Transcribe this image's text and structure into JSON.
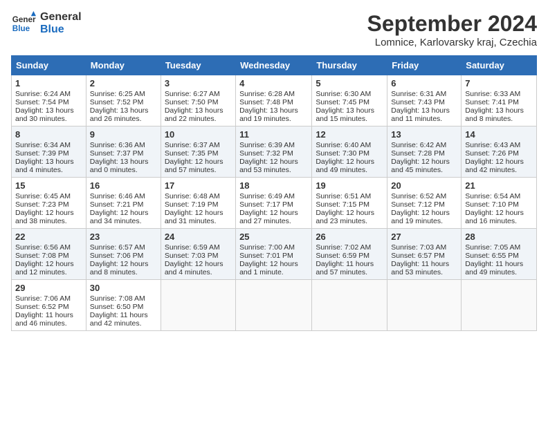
{
  "header": {
    "logo_line1": "General",
    "logo_line2": "Blue",
    "month_title": "September 2024",
    "location": "Lomnice, Karlovarsky kraj, Czechia"
  },
  "columns": [
    "Sunday",
    "Monday",
    "Tuesday",
    "Wednesday",
    "Thursday",
    "Friday",
    "Saturday"
  ],
  "weeks": [
    [
      {
        "day": "1",
        "info": "Sunrise: 6:24 AM\nSunset: 7:54 PM\nDaylight: 13 hours\nand 30 minutes."
      },
      {
        "day": "2",
        "info": "Sunrise: 6:25 AM\nSunset: 7:52 PM\nDaylight: 13 hours\nand 26 minutes."
      },
      {
        "day": "3",
        "info": "Sunrise: 6:27 AM\nSunset: 7:50 PM\nDaylight: 13 hours\nand 22 minutes."
      },
      {
        "day": "4",
        "info": "Sunrise: 6:28 AM\nSunset: 7:48 PM\nDaylight: 13 hours\nand 19 minutes."
      },
      {
        "day": "5",
        "info": "Sunrise: 6:30 AM\nSunset: 7:45 PM\nDaylight: 13 hours\nand 15 minutes."
      },
      {
        "day": "6",
        "info": "Sunrise: 6:31 AM\nSunset: 7:43 PM\nDaylight: 13 hours\nand 11 minutes."
      },
      {
        "day": "7",
        "info": "Sunrise: 6:33 AM\nSunset: 7:41 PM\nDaylight: 13 hours\nand 8 minutes."
      }
    ],
    [
      {
        "day": "8",
        "info": "Sunrise: 6:34 AM\nSunset: 7:39 PM\nDaylight: 13 hours\nand 4 minutes."
      },
      {
        "day": "9",
        "info": "Sunrise: 6:36 AM\nSunset: 7:37 PM\nDaylight: 13 hours\nand 0 minutes."
      },
      {
        "day": "10",
        "info": "Sunrise: 6:37 AM\nSunset: 7:35 PM\nDaylight: 12 hours\nand 57 minutes."
      },
      {
        "day": "11",
        "info": "Sunrise: 6:39 AM\nSunset: 7:32 PM\nDaylight: 12 hours\nand 53 minutes."
      },
      {
        "day": "12",
        "info": "Sunrise: 6:40 AM\nSunset: 7:30 PM\nDaylight: 12 hours\nand 49 minutes."
      },
      {
        "day": "13",
        "info": "Sunrise: 6:42 AM\nSunset: 7:28 PM\nDaylight: 12 hours\nand 45 minutes."
      },
      {
        "day": "14",
        "info": "Sunrise: 6:43 AM\nSunset: 7:26 PM\nDaylight: 12 hours\nand 42 minutes."
      }
    ],
    [
      {
        "day": "15",
        "info": "Sunrise: 6:45 AM\nSunset: 7:23 PM\nDaylight: 12 hours\nand 38 minutes."
      },
      {
        "day": "16",
        "info": "Sunrise: 6:46 AM\nSunset: 7:21 PM\nDaylight: 12 hours\nand 34 minutes."
      },
      {
        "day": "17",
        "info": "Sunrise: 6:48 AM\nSunset: 7:19 PM\nDaylight: 12 hours\nand 31 minutes."
      },
      {
        "day": "18",
        "info": "Sunrise: 6:49 AM\nSunset: 7:17 PM\nDaylight: 12 hours\nand 27 minutes."
      },
      {
        "day": "19",
        "info": "Sunrise: 6:51 AM\nSunset: 7:15 PM\nDaylight: 12 hours\nand 23 minutes."
      },
      {
        "day": "20",
        "info": "Sunrise: 6:52 AM\nSunset: 7:12 PM\nDaylight: 12 hours\nand 19 minutes."
      },
      {
        "day": "21",
        "info": "Sunrise: 6:54 AM\nSunset: 7:10 PM\nDaylight: 12 hours\nand 16 minutes."
      }
    ],
    [
      {
        "day": "22",
        "info": "Sunrise: 6:56 AM\nSunset: 7:08 PM\nDaylight: 12 hours\nand 12 minutes."
      },
      {
        "day": "23",
        "info": "Sunrise: 6:57 AM\nSunset: 7:06 PM\nDaylight: 12 hours\nand 8 minutes."
      },
      {
        "day": "24",
        "info": "Sunrise: 6:59 AM\nSunset: 7:03 PM\nDaylight: 12 hours\nand 4 minutes."
      },
      {
        "day": "25",
        "info": "Sunrise: 7:00 AM\nSunset: 7:01 PM\nDaylight: 12 hours\nand 1 minute."
      },
      {
        "day": "26",
        "info": "Sunrise: 7:02 AM\nSunset: 6:59 PM\nDaylight: 11 hours\nand 57 minutes."
      },
      {
        "day": "27",
        "info": "Sunrise: 7:03 AM\nSunset: 6:57 PM\nDaylight: 11 hours\nand 53 minutes."
      },
      {
        "day": "28",
        "info": "Sunrise: 7:05 AM\nSunset: 6:55 PM\nDaylight: 11 hours\nand 49 minutes."
      }
    ],
    [
      {
        "day": "29",
        "info": "Sunrise: 7:06 AM\nSunset: 6:52 PM\nDaylight: 11 hours\nand 46 minutes."
      },
      {
        "day": "30",
        "info": "Sunrise: 7:08 AM\nSunset: 6:50 PM\nDaylight: 11 hours\nand 42 minutes."
      },
      {
        "day": "",
        "info": ""
      },
      {
        "day": "",
        "info": ""
      },
      {
        "day": "",
        "info": ""
      },
      {
        "day": "",
        "info": ""
      },
      {
        "day": "",
        "info": ""
      }
    ]
  ]
}
